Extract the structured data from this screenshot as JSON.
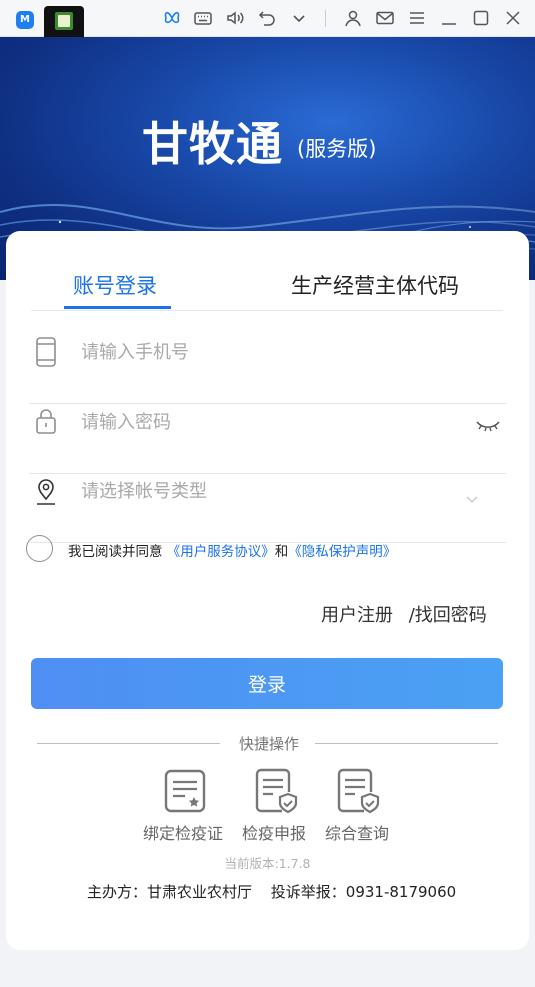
{
  "titlebar": {
    "app_icon_letter": "M",
    "icons": [
      "butterfly-icon",
      "keyboard-icon",
      "volume-icon",
      "undo-icon",
      "chevron-down-icon",
      "user-icon",
      "mail-icon",
      "menu-icon",
      "minimize-icon",
      "maximize-icon",
      "close-icon"
    ]
  },
  "banner": {
    "title": "甘牧通",
    "subtitle": "(服务版)"
  },
  "tabs": {
    "account_login": "账号登录",
    "entity_code": "生产经营主体代码"
  },
  "form": {
    "phone_placeholder": "请输入手机号",
    "password_placeholder": "请输入密码",
    "account_type_placeholder": "请选择帐号类型"
  },
  "agreement": {
    "prefix": "我已阅读并同意",
    "user_agreement": "《用户服务协议》",
    "and": "和",
    "privacy_statement": "《隐私保护声明》"
  },
  "links": {
    "register": "用户注册",
    "retrieve_password": "/找回密码"
  },
  "login_button": "登录",
  "quick": {
    "title": "快捷操作",
    "items": [
      {
        "label": "绑定检疫证",
        "icon": "certificate-star-icon"
      },
      {
        "label": "检疫申报",
        "icon": "document-shield-icon"
      },
      {
        "label": "综合查询",
        "icon": "document-shield-icon"
      }
    ]
  },
  "version": "当前版本:1.7.8",
  "footer": {
    "organizer": "主办方：甘肃农业农村厅",
    "complaint": "投诉举报：0931-8179060"
  },
  "colors": {
    "accent": "#1a73e8",
    "button": "#4a96f3",
    "banner_dark": "#0f2f82"
  }
}
